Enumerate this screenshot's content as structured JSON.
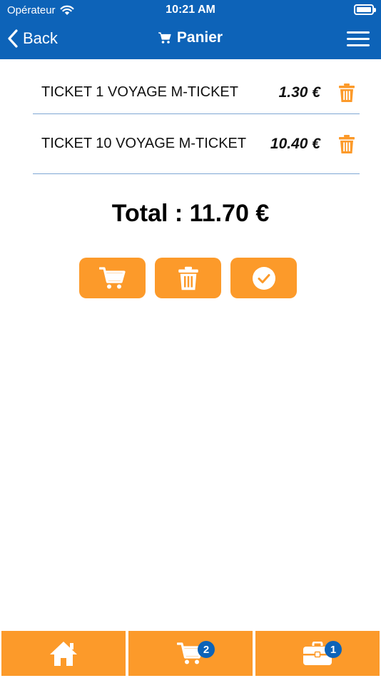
{
  "status_bar": {
    "carrier": "Opérateur",
    "time": "10:21 AM"
  },
  "nav": {
    "back_label": "Back",
    "title": "Panier"
  },
  "cart": {
    "items": [
      {
        "name": "TICKET 1 VOYAGE M-TICKET",
        "price": "1.30 €"
      },
      {
        "name": "TICKET 10 VOYAGE M-TICKET",
        "price": "10.40 €"
      }
    ],
    "total": "Total : 11.70 €"
  },
  "tab_bar": {
    "cart_badge": "2",
    "tools_badge": "1"
  },
  "colors": {
    "header": "#0d63b8",
    "accent": "#fc9a2a",
    "divider": "#7fa7d4"
  },
  "icons": [
    "wifi-icon",
    "battery-icon",
    "back-chevron-icon",
    "cart-icon",
    "menu-icon",
    "trash-icon",
    "checkmark-icon",
    "home-icon",
    "toolbox-icon"
  ]
}
